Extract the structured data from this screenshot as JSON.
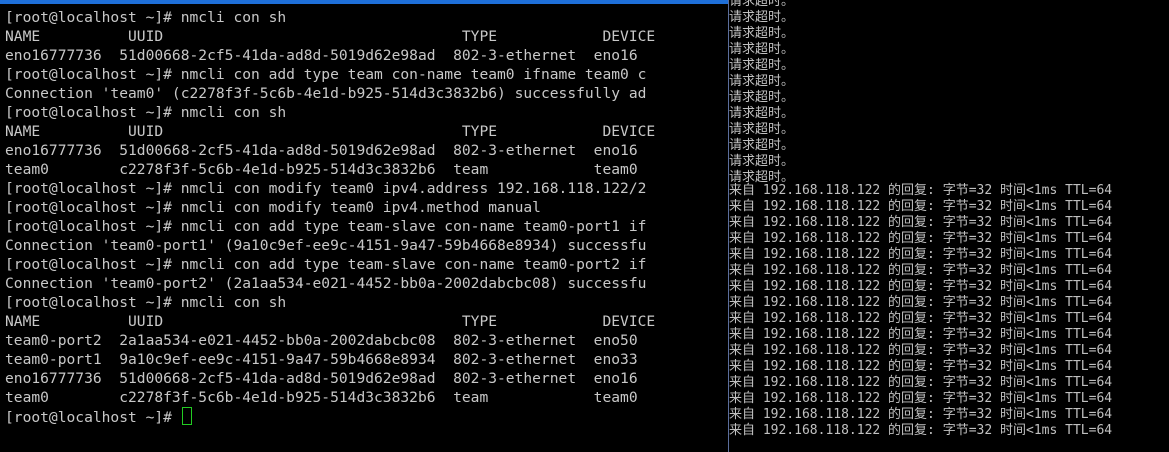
{
  "terminal": {
    "lines": [
      "[root@localhost ~]# nmcli con sh",
      "NAME          UUID                                  TYPE            DEVICE",
      "eno16777736  51d00668-2cf5-41da-ad8d-5019d62e98ad  802-3-ethernet  eno16",
      "[root@localhost ~]# nmcli con add type team con-name team0 ifname team0 c",
      "Connection 'team0' (c2278f3f-5c6b-4e1d-b925-514d3c3832b6) successfully ad",
      "[root@localhost ~]# nmcli con sh",
      "NAME          UUID                                  TYPE            DEVICE",
      "eno16777736  51d00668-2cf5-41da-ad8d-5019d62e98ad  802-3-ethernet  eno16",
      "team0        c2278f3f-5c6b-4e1d-b925-514d3c3832b6  team            team0",
      "[root@localhost ~]# nmcli con modify team0 ipv4.address 192.168.118.122/2",
      "[root@localhost ~]# nmcli con modify team0 ipv4.method manual",
      "[root@localhost ~]# nmcli con add type team-slave con-name team0-port1 if",
      "Connection 'team0-port1' (9a10c9ef-ee9c-4151-9a47-59b4668e8934) successfu",
      "[root@localhost ~]# nmcli con add type team-slave con-name team0-port2 if",
      "Connection 'team0-port2' (2a1aa534-e021-4452-bb0a-2002dabcbc08) successfu",
      "[root@localhost ~]# nmcli con sh",
      "NAME          UUID                                  TYPE            DEVICE",
      "team0-port2  2a1aa534-e021-4452-bb0a-2002dabcbc08  802-3-ethernet  eno50",
      "team0-port1  9a10c9ef-ee9c-4151-9a47-59b4668e8934  802-3-ethernet  eno33",
      "eno16777736  51d00668-2cf5-41da-ad8d-5019d62e98ad  802-3-ethernet  eno16",
      "team0        c2278f3f-5c6b-4e1d-b925-514d3c3832b6  team            team0"
    ],
    "prompt": "[root@localhost ~]# "
  },
  "ping_window": {
    "timeout_lines": [
      "请求超时。",
      "请求超时。",
      "请求超时。",
      "请求超时。",
      "请求超时。",
      "请求超时。",
      "请求超时。",
      "请求超时。",
      "请求超时。",
      "请求超时。",
      "请求超时。",
      "请求超时。"
    ],
    "reply_lines": [
      "来自 192.168.118.122 的回复: 字节=32 时间<1ms TTL=64",
      "来自 192.168.118.122 的回复: 字节=32 时间<1ms TTL=64",
      "来自 192.168.118.122 的回复: 字节=32 时间<1ms TTL=64",
      "来自 192.168.118.122 的回复: 字节=32 时间<1ms TTL=64",
      "来自 192.168.118.122 的回复: 字节=32 时间<1ms TTL=64",
      "来自 192.168.118.122 的回复: 字节=32 时间<1ms TTL=64",
      "来自 192.168.118.122 的回复: 字节=32 时间<1ms TTL=64",
      "来自 192.168.118.122 的回复: 字节=32 时间<1ms TTL=64",
      "来自 192.168.118.122 的回复: 字节=32 时间<1ms TTL=64",
      "来自 192.168.118.122 的回复: 字节=32 时间<1ms TTL=64",
      "来自 192.168.118.122 的回复: 字节=32 时间<1ms TTL=64",
      "来自 192.168.118.122 的回复: 字节=32 时间<1ms TTL=64",
      "来自 192.168.118.122 的回复: 字节=32 时间<1ms TTL=64",
      "来自 192.168.118.122 的回复: 字节=32 时间<1ms TTL=64",
      "来自 192.168.118.122 的回复: 字节=32 时间<1ms TTL=64",
      "来自 192.168.118.122 的回复: 字节=32 时间<1ms TTL=64"
    ]
  }
}
